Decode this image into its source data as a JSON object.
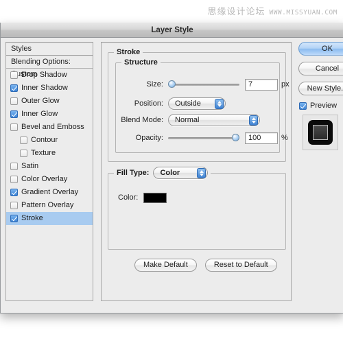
{
  "watermark": {
    "cn_text": "思缘设计论坛",
    "url_text": "WWW.MISSYUAN.COM"
  },
  "window": {
    "title": "Layer Style"
  },
  "styles_panel": {
    "header_label": "Styles",
    "blending_options_label": "Blending Options: Custom",
    "items": [
      {
        "label": "Drop Shadow",
        "checked": false,
        "indent": false,
        "selected": false
      },
      {
        "label": "Inner Shadow",
        "checked": true,
        "indent": false,
        "selected": false
      },
      {
        "label": "Outer Glow",
        "checked": false,
        "indent": false,
        "selected": false
      },
      {
        "label": "Inner Glow",
        "checked": true,
        "indent": false,
        "selected": false
      },
      {
        "label": "Bevel and Emboss",
        "checked": false,
        "indent": false,
        "selected": false
      },
      {
        "label": "Contour",
        "checked": false,
        "indent": true,
        "selected": false
      },
      {
        "label": "Texture",
        "checked": false,
        "indent": true,
        "selected": false
      },
      {
        "label": "Satin",
        "checked": false,
        "indent": false,
        "selected": false
      },
      {
        "label": "Color Overlay",
        "checked": false,
        "indent": false,
        "selected": false
      },
      {
        "label": "Gradient Overlay",
        "checked": true,
        "indent": false,
        "selected": false
      },
      {
        "label": "Pattern Overlay",
        "checked": false,
        "indent": false,
        "selected": false
      },
      {
        "label": "Stroke",
        "checked": true,
        "indent": false,
        "selected": true
      }
    ]
  },
  "stroke_panel": {
    "group_label": "Stroke",
    "structure": {
      "group_label": "Structure",
      "size": {
        "label": "Size:",
        "value": "7",
        "unit": "px",
        "slider_position_pct": 0
      },
      "position": {
        "label": "Position:",
        "value": "Outside"
      },
      "blend_mode": {
        "label": "Blend Mode:",
        "value": "Normal"
      },
      "opacity": {
        "label": "Opacity:",
        "value": "100",
        "unit": "%",
        "slider_position_pct": 100
      }
    },
    "fill_type": {
      "group_label": "Fill Type:",
      "value": "Color",
      "color": {
        "label": "Color:",
        "swatch_hex": "#000000"
      }
    },
    "buttons": {
      "make_default": "Make Default",
      "reset_to_default": "Reset to Default"
    }
  },
  "right_column": {
    "ok_label": "OK",
    "cancel_label": "Cancel",
    "new_style_label": "New Style...",
    "preview_label": "Preview",
    "preview_checked": true
  },
  "colors": {
    "selection_blue": "#a8cbf0",
    "checkbox_blue": "#3d84d6",
    "default_button_blue": "#8cbcef",
    "dialog_bg": "#ececec"
  }
}
